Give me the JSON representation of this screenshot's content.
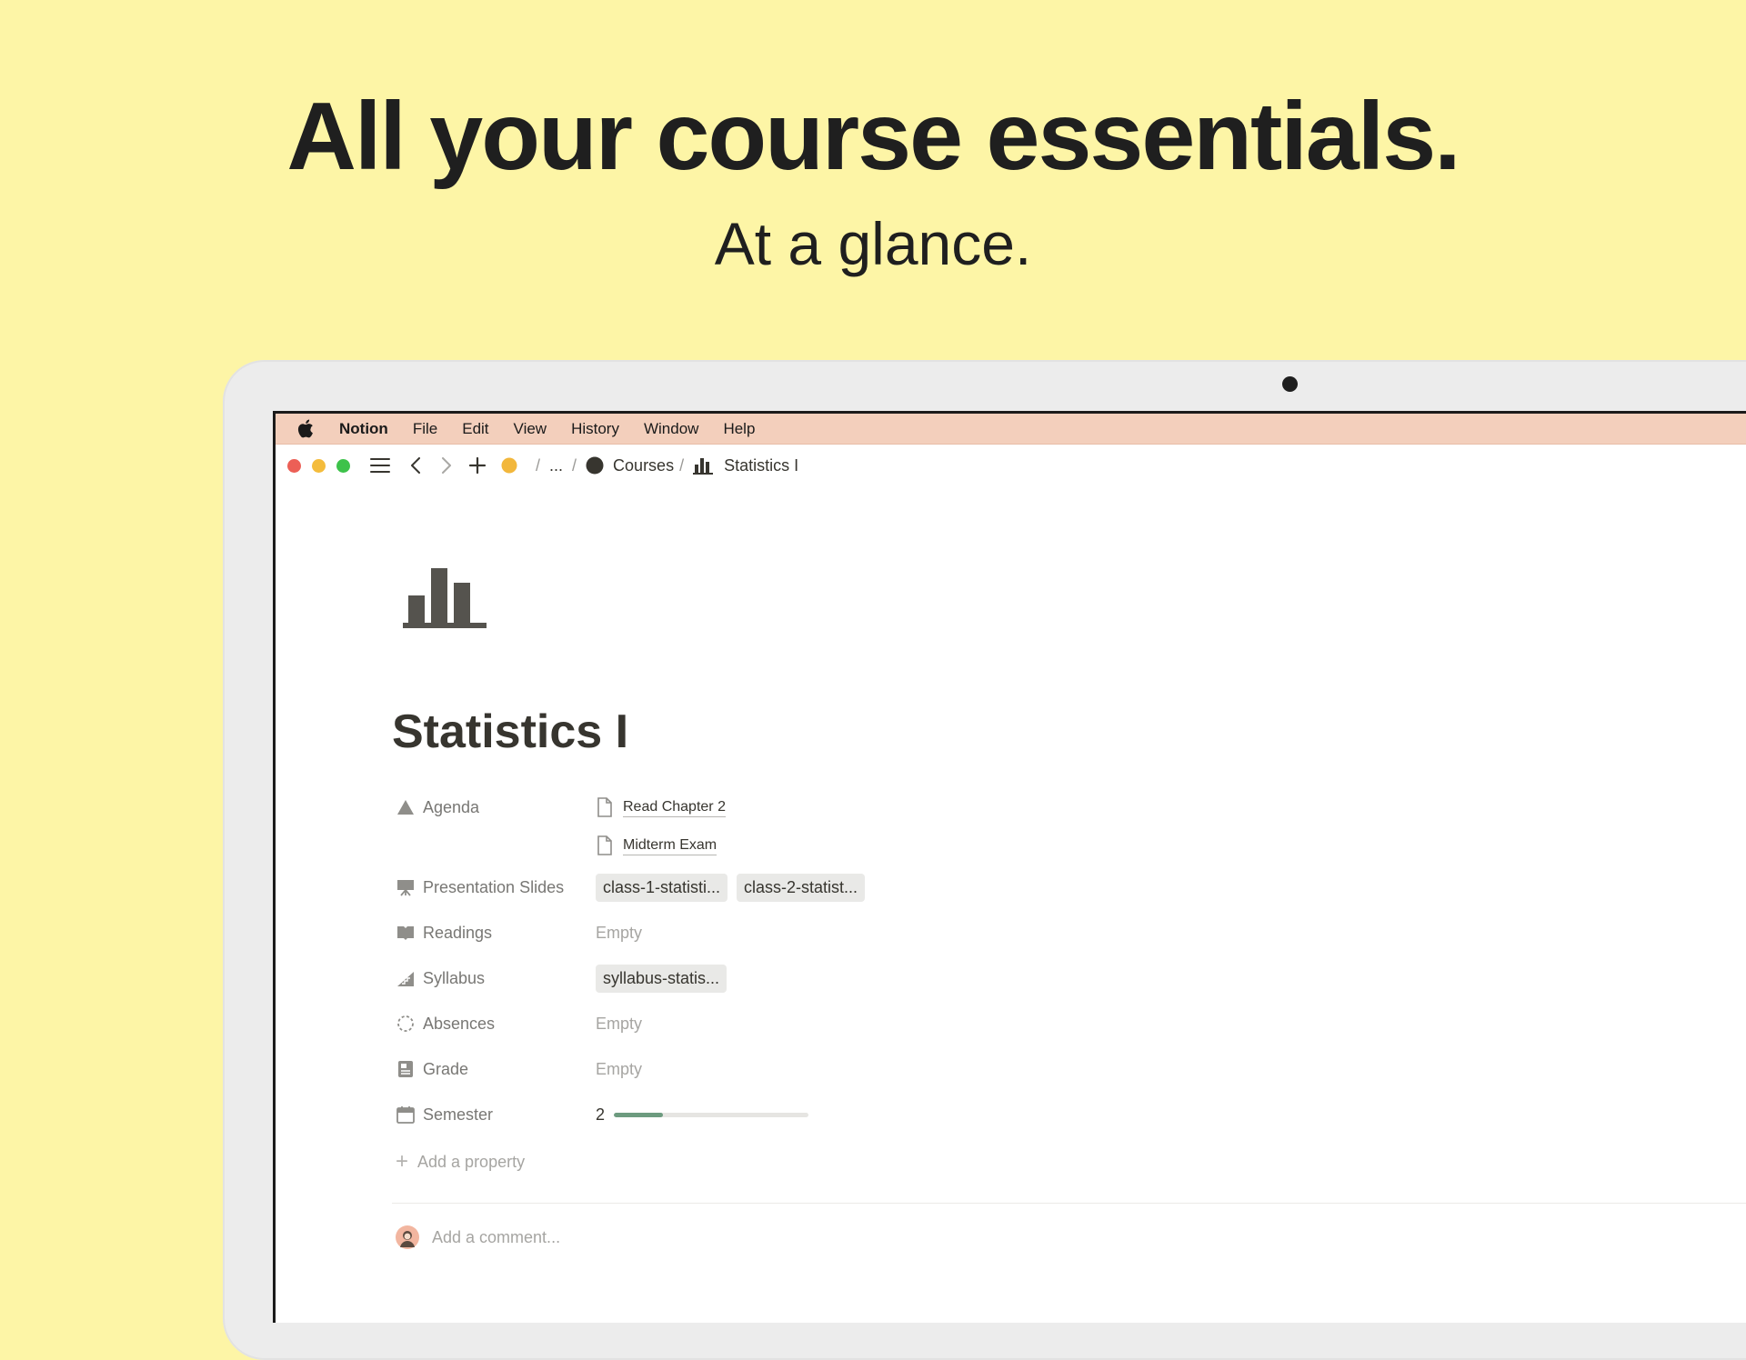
{
  "hero": {
    "title": "All your course essentials.",
    "subtitle": "At a glance."
  },
  "menubar": {
    "app_name": "Notion",
    "items": [
      "File",
      "Edit",
      "View",
      "History",
      "Window",
      "Help"
    ]
  },
  "toolbar": {
    "breadcrumb": {
      "ellipsis": "...",
      "parent": "Courses",
      "current": "Statistics I",
      "separator": "/"
    }
  },
  "page": {
    "icon": "bar-chart-icon",
    "title": "Statistics I",
    "properties": {
      "agenda": {
        "label": "Agenda",
        "icon": "triangle-icon",
        "items": [
          "Read Chapter 2",
          "Midterm Exam"
        ]
      },
      "slides": {
        "label": "Presentation Slides",
        "icon": "presentation-icon",
        "files": [
          "class-1-statisti...",
          "class-2-statist..."
        ]
      },
      "readings": {
        "label": "Readings",
        "icon": "book-icon",
        "value": "Empty"
      },
      "syllabus": {
        "label": "Syllabus",
        "icon": "chart-icon",
        "files": [
          "syllabus-statis..."
        ]
      },
      "absences": {
        "label": "Absences",
        "icon": "dashed-circle-icon",
        "value": "Empty"
      },
      "grade": {
        "label": "Grade",
        "icon": "grade-icon",
        "value": "Empty"
      },
      "semester": {
        "label": "Semester",
        "icon": "calendar-icon",
        "value": "2",
        "progress": 0.25
      }
    },
    "add_property": "Add a property",
    "comment_placeholder": "Add a comment..."
  },
  "colors": {
    "background": "#fdf5a6",
    "menubar": "#f3cfbc",
    "progress": "#6d9b7f",
    "close": "#ec5f56",
    "minimize": "#f4bc3c",
    "zoom": "#3dc24a",
    "workspace_dot": "#f2b73c"
  }
}
